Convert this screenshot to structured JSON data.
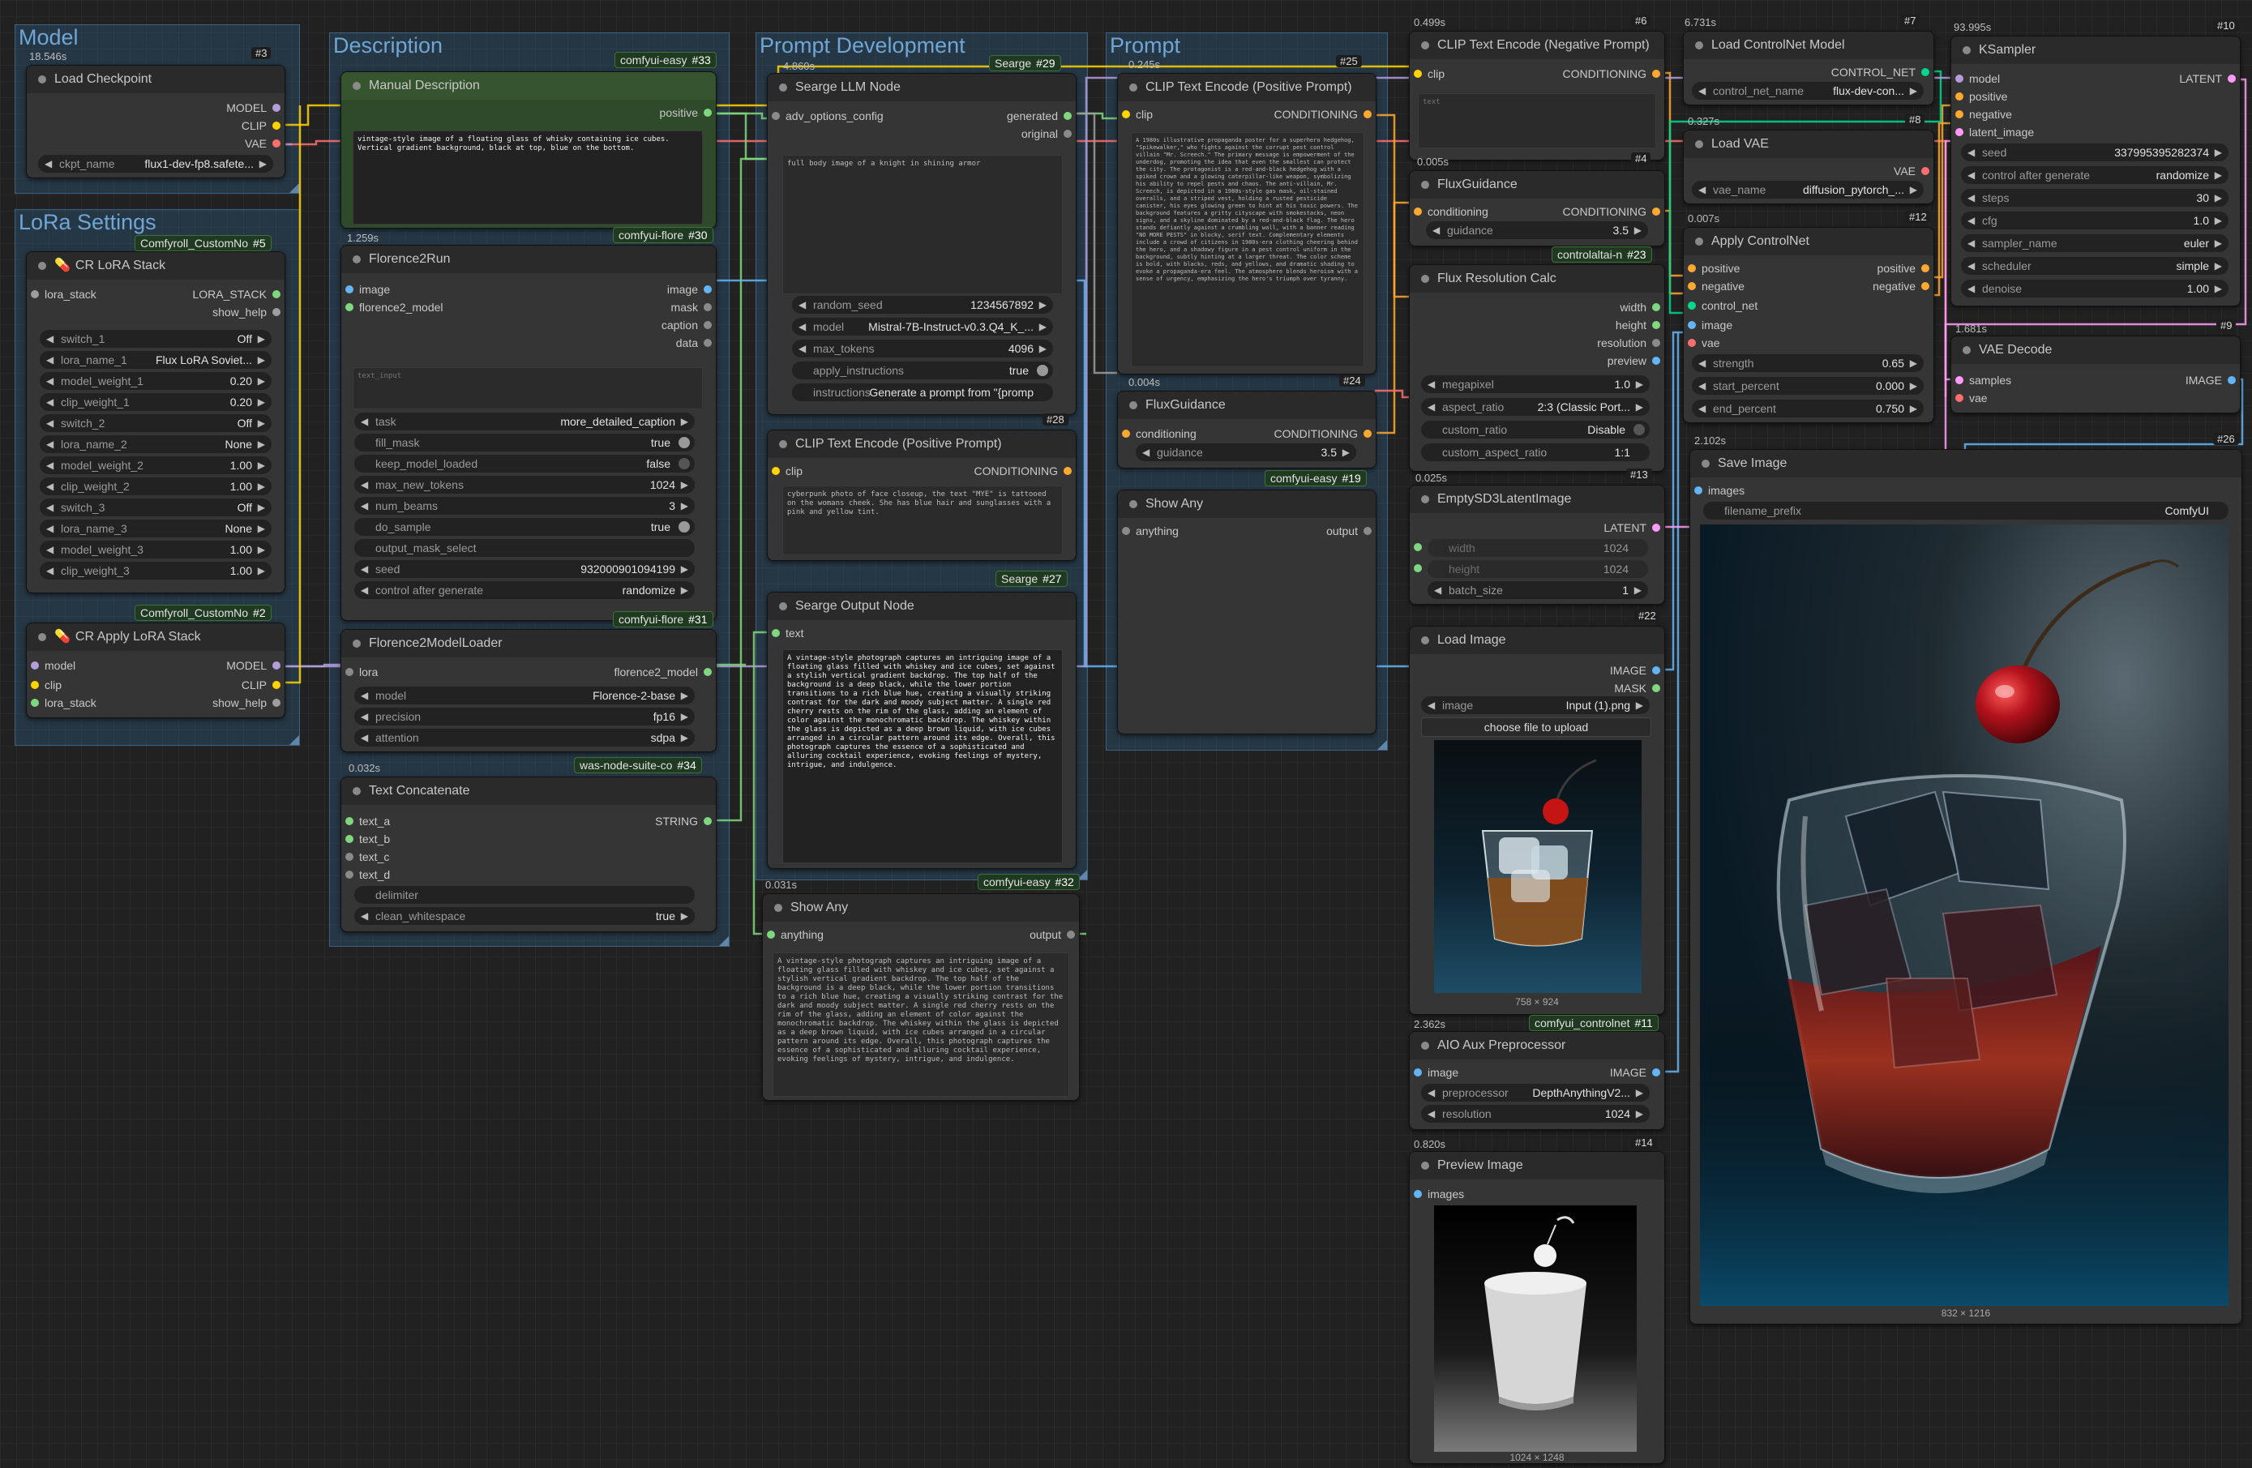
{
  "groups": {
    "model": "Model",
    "lora": "LoRa Settings",
    "description": "Description",
    "prompt_dev": "Prompt Development",
    "prompt": "Prompt"
  },
  "badges": {
    "b3": {
      "label": "",
      "num": "#3"
    },
    "b33": {
      "label": "comfyui-easy",
      "num": "#33"
    },
    "b29": {
      "label": "Searge",
      "num": "#29"
    },
    "b25": {
      "label": "",
      "num": "#25"
    },
    "b6": {
      "label": "",
      "num": "#6"
    },
    "b7": {
      "label": "",
      "num": "#7"
    },
    "b10": {
      "label": "",
      "num": "#10"
    },
    "b5": {
      "label": "Comfyroll_CustomNo",
      "num": "#5"
    },
    "b30": {
      "label": "comfyui-flore",
      "num": "#30"
    },
    "b4": {
      "label": "",
      "num": "#4"
    },
    "b8": {
      "label": "",
      "num": "#8"
    },
    "b12": {
      "label": "",
      "num": "#12"
    },
    "b23": {
      "label": "controlaltai-n",
      "num": "#23"
    },
    "b9": {
      "label": "",
      "num": "#9"
    },
    "b28": {
      "label": "",
      "num": "#28"
    },
    "b24": {
      "label": "",
      "num": "#24"
    },
    "b26": {
      "label": "",
      "num": "#26"
    },
    "b27": {
      "label": "Searge",
      "num": "#27"
    },
    "b13": {
      "label": "",
      "num": "#13"
    },
    "b19": {
      "label": "comfyui-easy",
      "num": "#19"
    },
    "b2": {
      "label": "Comfyroll_CustomNo",
      "num": "#2"
    },
    "b31": {
      "label": "comfyui-flore",
      "num": "#31"
    },
    "b22": {
      "label": "",
      "num": "#22"
    },
    "b34": {
      "label": "was-node-suite-co",
      "num": "#34"
    },
    "b32": {
      "label": "comfyui-easy",
      "num": "#32"
    },
    "b11": {
      "label": "comfyui_controlnet",
      "num": "#11"
    },
    "b14": {
      "label": "",
      "num": "#14"
    }
  },
  "timings": {
    "t3": "18.546s",
    "t29": "4.860s",
    "t25": "0.245s",
    "t6": "0.499s",
    "t7": "6.731s",
    "t10": "93.995s",
    "t30": "1.259s",
    "t4": "0.005s",
    "t8": "0.327s",
    "t12": "0.007s",
    "t9": "1.681s",
    "t24": "0.004s",
    "t26": "2.102s",
    "t13": "0.025s",
    "t34": "0.032s",
    "t32": "0.031s",
    "t11": "2.362s",
    "t14": "0.820s"
  },
  "nodes": {
    "load_checkpoint": {
      "title": "Load Checkpoint",
      "outputs": [
        "MODEL",
        "CLIP",
        "VAE"
      ],
      "ckpt_label": "ckpt_name",
      "ckpt_value": "flux1-dev-fp8.safete..."
    },
    "cr_lora_stack": {
      "title": "CR LoRA Stack",
      "input": "lora_stack",
      "outputs": [
        "LORA_STACK",
        "show_help"
      ],
      "widgets": [
        {
          "label": "switch_1",
          "value": "Off"
        },
        {
          "label": "lora_name_1",
          "value": "Flux LoRA Soviet..."
        },
        {
          "label": "model_weight_1",
          "value": "0.20"
        },
        {
          "label": "clip_weight_1",
          "value": "0.20"
        },
        {
          "label": "switch_2",
          "value": "Off"
        },
        {
          "label": "lora_name_2",
          "value": "None"
        },
        {
          "label": "model_weight_2",
          "value": "1.00"
        },
        {
          "label": "clip_weight_2",
          "value": "1.00"
        },
        {
          "label": "switch_3",
          "value": "Off"
        },
        {
          "label": "lora_name_3",
          "value": "None"
        },
        {
          "label": "model_weight_3",
          "value": "1.00"
        },
        {
          "label": "clip_weight_3",
          "value": "1.00"
        }
      ]
    },
    "cr_apply_lora_stack": {
      "title": "CR Apply LoRA Stack",
      "inputs": [
        "model",
        "clip",
        "lora_stack"
      ],
      "outputs": [
        "MODEL",
        "CLIP",
        "show_help"
      ]
    },
    "manual_description": {
      "title": "Manual Description",
      "output": "positive",
      "text": "vintage-style image of a floating glass of whisky containing ice cubes. Vertical gradient background, black at top, blue on the bottom."
    },
    "florence2run": {
      "title": "Florence2Run",
      "inputs": [
        "image",
        "florence2_model"
      ],
      "outputs": [
        "image",
        "mask",
        "caption",
        "data"
      ],
      "text_placeholder": "text_input",
      "widgets": [
        {
          "label": "task",
          "value": "more_detailed_caption",
          "kind": "combo"
        },
        {
          "label": "fill_mask",
          "value": "true",
          "kind": "toggle"
        },
        {
          "label": "keep_model_loaded",
          "value": "false",
          "kind": "toggle-off"
        },
        {
          "label": "max_new_tokens",
          "value": "1024",
          "kind": "combo"
        },
        {
          "label": "num_beams",
          "value": "3",
          "kind": "combo"
        },
        {
          "label": "do_sample",
          "value": "true",
          "kind": "toggle"
        },
        {
          "label": "output_mask_select",
          "value": "",
          "kind": "text"
        },
        {
          "label": "seed",
          "value": "932000901094199",
          "kind": "combo"
        },
        {
          "label": "control after generate",
          "value": "randomize",
          "kind": "combo"
        }
      ]
    },
    "florence2_loader": {
      "title": "Florence2ModelLoader",
      "input": "lora",
      "output": "florence2_model",
      "widgets": [
        {
          "label": "model",
          "value": "Florence-2-base"
        },
        {
          "label": "precision",
          "value": "fp16"
        },
        {
          "label": "attention",
          "value": "sdpa"
        }
      ]
    },
    "text_concatenate": {
      "title": "Text Concatenate",
      "inputs": [
        "text_a",
        "text_b",
        "text_c",
        "text_d"
      ],
      "output": "STRING",
      "widgets": [
        {
          "label": "delimiter",
          "value": ""
        },
        {
          "label": "clean_whitespace",
          "value": "true"
        }
      ]
    },
    "searge_llm": {
      "title": "Searge LLM Node",
      "input": "adv_options_config",
      "outputs": [
        "generated",
        "original"
      ],
      "text": "full body image of a knight in shining armor",
      "widgets": [
        {
          "label": "random_seed",
          "value": "1234567892",
          "kind": "combo"
        },
        {
          "label": "model",
          "value": "Mistral-7B-Instruct-v0.3.Q4_K_...",
          "kind": "combo"
        },
        {
          "label": "max_tokens",
          "value": "4096",
          "kind": "combo"
        },
        {
          "label": "apply_instructions",
          "value": "true",
          "kind": "toggle"
        },
        {
          "label": "instructions",
          "value": "Generate a prompt from \"{promp",
          "kind": "text"
        }
      ]
    },
    "clip_pos_dev": {
      "title": "CLIP Text Encode (Positive Prompt)",
      "input": "clip",
      "output": "CONDITIONING",
      "text": "cyberpunk photo of face closeup, the text \"MYE\" is tattooed on the womans cheek. She has blue hair and sunglasses with a pink and yellow tint."
    },
    "searge_output": {
      "title": "Searge Output Node",
      "input": "text",
      "text": "A vintage-style photograph captures an intriguing image of a floating glass filled with whiskey and ice cubes, set against a stylish vertical gradient backdrop. The top half of the background is a deep black, while the lower portion transitions to a rich blue hue, creating a visually striking contrast for the dark and moody subject matter. A single red cherry rests on the rim of the glass, adding an element of color against the monochromatic backdrop. The whiskey within the glass is depicted as a deep brown liquid, with ice cubes arranged in a circular pattern around its edge. Overall, this photograph captures the essence of a sophisticated and alluring cocktail experience, evoking feelings of mystery, intrigue, and indulgence."
    },
    "show_any_bottom": {
      "title": "Show Any",
      "input": "anything",
      "output": "output",
      "text": "A vintage-style photograph captures an intriguing image of a floating glass filled with whiskey and ice cubes, set against a stylish vertical gradient backdrop. The top half of the background is a deep black, while the lower portion transitions to a rich blue hue, creating a visually striking contrast for the dark and moody subject matter. A single red cherry rests on the rim of the glass, adding an element of color against the monochromatic backdrop. The whiskey within the glass is depicted as a deep brown liquid, with ice cubes arranged in a circular pattern around its edge. Overall, this photograph captures the essence of a sophisticated and alluring cocktail experience, evoking feelings of mystery, intrigue, and indulgence."
    },
    "clip_pos_prompt": {
      "title": "CLIP Text Encode (Positive Prompt)",
      "input": "clip",
      "output": "CONDITIONING",
      "text": "A 1980s illustrative propaganda poster for a superhero hedgehog, \"Spikewalker,\" who fights against the corrupt pest control villain \"Mr. Screech.\" The primary message is empowerment of the underdog, promoting the idea that even the smallest can protect the city. The protagonist is a red-and-black hedgehog with a spiked crown and a glowing caterpillar-like weapon, symbolizing his ability to repel pests and chaos. The anti-villain, Mr. Screech, is depicted in a 1980s-style gas mask, oil-stained overalls, and a striped vest, holding a rusted pesticide canister, his eyes glowing green to hint at his toxic powers. The background features a gritty cityscape with smokestacks, neon signs, and a skyline dominated by a red-and-black flag. The hero stands defiantly against a crumbling wall, with a banner reading \"NO MORE PESTS\" in blocky, serif text. Complementary elements include a crowd of citizens in 1980s-era clothing cheering behind the hero, and a shadowy figure in a pest control uniform in the background, subtly hinting at a larger threat. The color scheme is bold, with blacks, reds, and yellows, and dramatic shading to evoke a propaganda-era feel. The atmosphere blends heroism with a sense of urgency, emphasizing the hero's triumph over tyranny."
    },
    "flux_guidance_prompt": {
      "title": "FluxGuidance",
      "input": "conditioning",
      "output": "CONDITIONING",
      "guidance_label": "guidance",
      "guidance_value": "3.5"
    },
    "show_any_prompt": {
      "title": "Show Any",
      "input": "anything",
      "output": "output"
    },
    "clip_neg": {
      "title": "CLIP Text Encode (Negative Prompt)",
      "input": "clip",
      "output": "CONDITIONING",
      "text": "text"
    },
    "flux_guidance_right": {
      "title": "FluxGuidance",
      "input": "conditioning",
      "output": "CONDITIONING",
      "guidance_label": "guidance",
      "guidance_value": "3.5"
    },
    "flux_resolution": {
      "title": "Flux Resolution Calc",
      "outputs": [
        "width",
        "height",
        "resolution",
        "preview"
      ],
      "widgets": [
        {
          "label": "megapixel",
          "value": "1.0",
          "kind": "combo"
        },
        {
          "label": "aspect_ratio",
          "value": "2:3 (Classic Port...",
          "kind": "combo"
        },
        {
          "label": "custom_ratio",
          "value": "Disable",
          "kind": "toggle-off"
        },
        {
          "label": "custom_aspect_ratio",
          "value": "1:1",
          "kind": "text"
        }
      ]
    },
    "empty_latent": {
      "title": "EmptySD3LatentImage",
      "output": "LATENT",
      "widgets": [
        {
          "label": "width",
          "value": "1024"
        },
        {
          "label": "height",
          "value": "1024"
        },
        {
          "label": "batch_size",
          "value": "1"
        }
      ]
    },
    "load_image": {
      "title": "Load Image",
      "outputs": [
        "IMAGE",
        "MASK"
      ],
      "image_label": "image",
      "image_value": "Input (1).png",
      "upload_label": "choose file to upload",
      "size": "758 × 924"
    },
    "aio_aux": {
      "title": "AIO Aux Preprocessor",
      "input": "image",
      "output": "IMAGE",
      "widgets": [
        {
          "label": "preprocessor",
          "value": "DepthAnythingV2..."
        },
        {
          "label": "resolution",
          "value": "1024"
        }
      ]
    },
    "preview_image": {
      "title": "Preview Image",
      "input": "images",
      "size": "1024 × 1248"
    },
    "load_controlnet": {
      "title": "Load ControlNet Model",
      "output": "CONTROL_NET",
      "widget_label": "control_net_name",
      "widget_value": "flux-dev-con..."
    },
    "load_vae": {
      "title": "Load VAE",
      "output": "VAE",
      "widget_label": "vae_name",
      "widget_value": "diffusion_pytorch_..."
    },
    "apply_controlnet": {
      "title": "Apply ControlNet",
      "inputs": [
        "positive",
        "negative",
        "control_net",
        "image",
        "vae"
      ],
      "outputs": [
        "positive",
        "negative"
      ],
      "widgets": [
        {
          "label": "strength",
          "value": "0.65"
        },
        {
          "label": "start_percent",
          "value": "0.000"
        },
        {
          "label": "end_percent",
          "value": "0.750"
        }
      ]
    },
    "ksampler": {
      "title": "KSampler",
      "inputs": [
        "model",
        "positive",
        "negative",
        "latent_image"
      ],
      "output": "LATENT",
      "widgets": [
        {
          "label": "seed",
          "value": "337995395282374"
        },
        {
          "label": "control after generate",
          "value": "randomize"
        },
        {
          "label": "steps",
          "value": "30"
        },
        {
          "label": "cfg",
          "value": "1.0"
        },
        {
          "label": "sampler_name",
          "value": "euler"
        },
        {
          "label": "scheduler",
          "value": "simple"
        },
        {
          "label": "denoise",
          "value": "1.00"
        }
      ]
    },
    "vae_decode": {
      "title": "VAE Decode",
      "inputs": [
        "samples",
        "vae"
      ],
      "output": "IMAGE"
    },
    "save_image": {
      "title": "Save Image",
      "input": "images",
      "widget_label": "filename_prefix",
      "widget_value": "ComfyUI",
      "size": "832 × 1216"
    }
  },
  "colors": {
    "model": "#b39ddb",
    "clip": "#ffd500",
    "vae": "#ff6e6e",
    "conditioning": "#ffa931",
    "string": "#7fd77f",
    "image": "#64b5f6",
    "latent": "#ff9cf9",
    "control_net": "#00d78d",
    "lora_stack": "#9e9e9e",
    "florence": "#7fd77f"
  }
}
